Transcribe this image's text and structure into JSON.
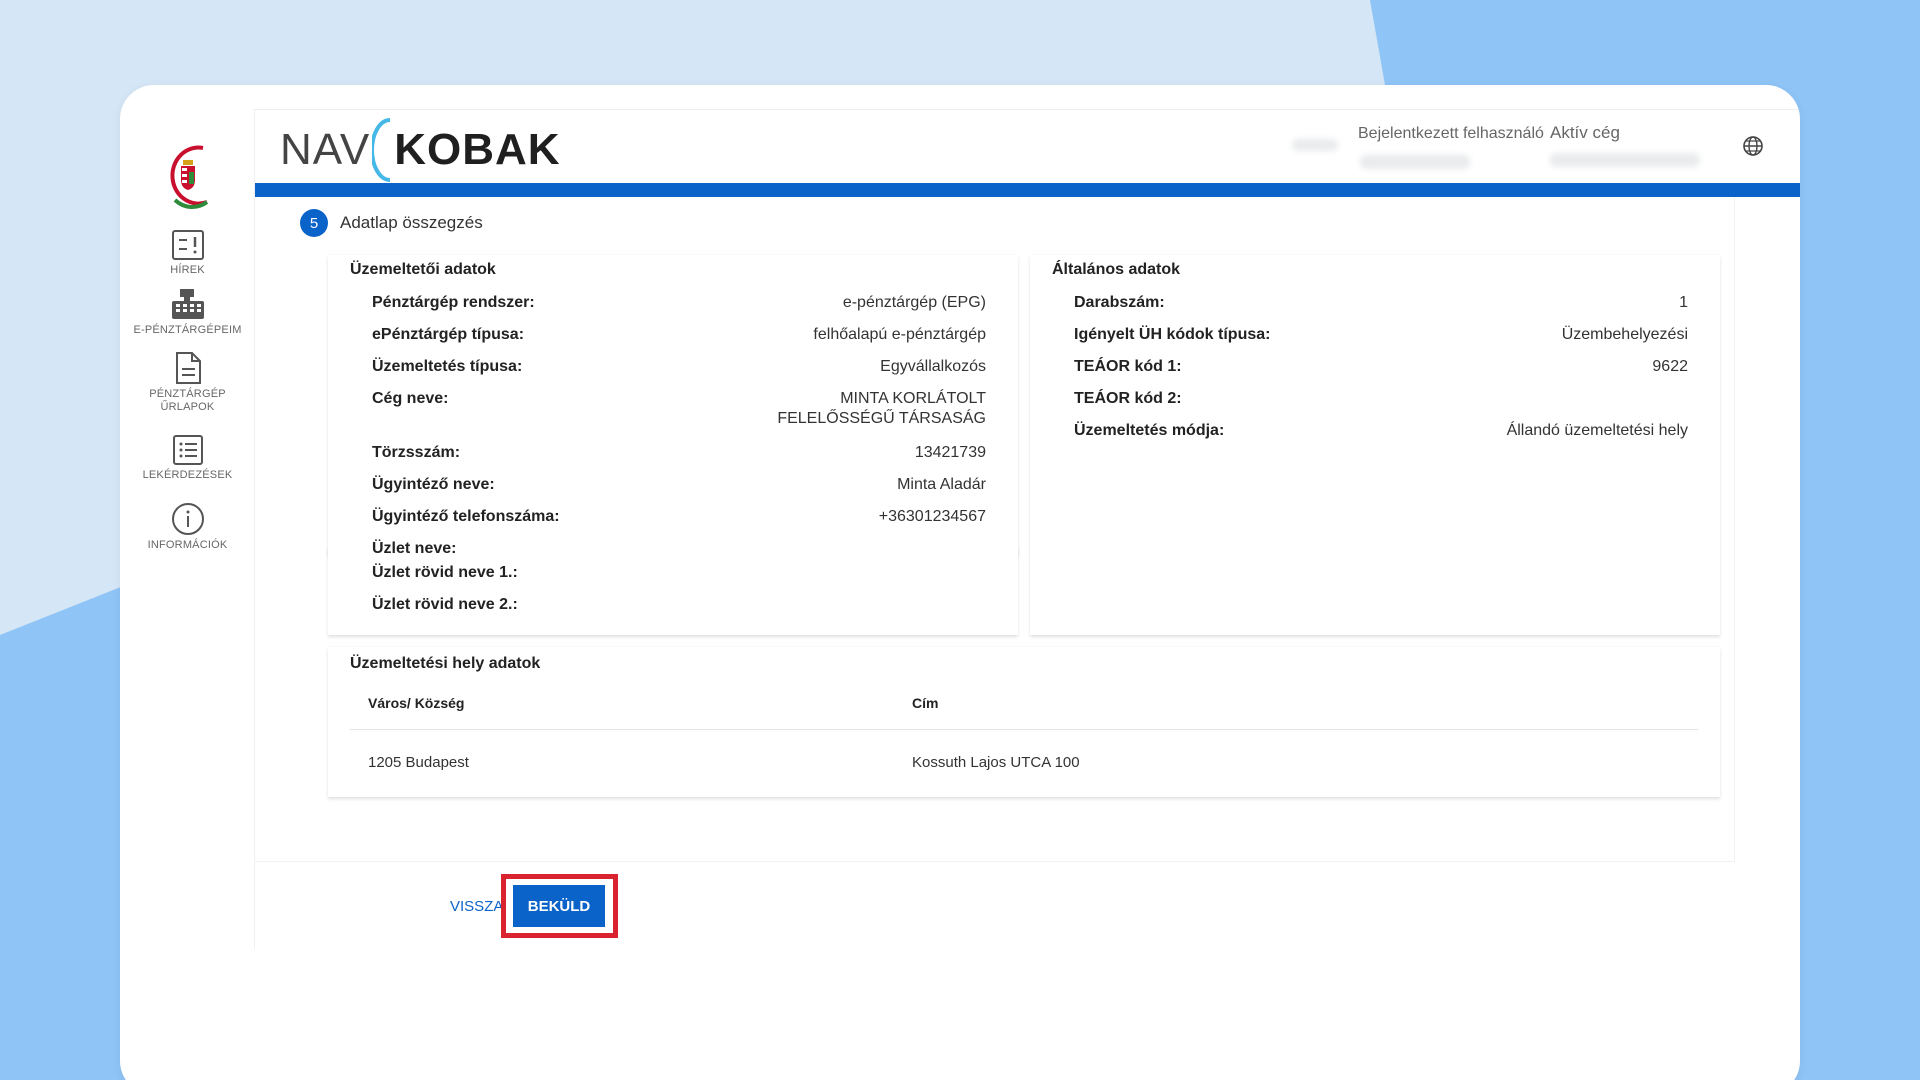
{
  "colors": {
    "brand_blue": "#0a63c9",
    "highlight_red": "#d9232f"
  },
  "brand": {
    "part1": "NAV",
    "part2": "KOBAK"
  },
  "header": {
    "user_label": "Bejelentkezett felhasználó",
    "company_label": "Aktív cég",
    "globe_icon": "globe-icon"
  },
  "sidebar": {
    "items": [
      {
        "label": "HÍREK",
        "icon": "news-icon"
      },
      {
        "label": "E-PÉNZTÁRGÉPEIM",
        "icon": "cash-register-icon"
      },
      {
        "label": "PÉNZTÁRGÉP ŰRLAPOK",
        "line1": "PÉNZTÁRGÉP",
        "line2": "ŰRLAPOK",
        "icon": "document-icon"
      },
      {
        "label": "LEKÉRDEZÉSEK",
        "icon": "list-icon"
      },
      {
        "label": "INFORMÁCIÓK",
        "icon": "info-icon"
      }
    ]
  },
  "step": {
    "number": "5",
    "title": "Adatlap összegzés"
  },
  "operator": {
    "title": "Üzemeltetői adatok",
    "rows": [
      {
        "key": "Pénztárgép rendszer:",
        "value": "e-pénztárgép (EPG)"
      },
      {
        "key": "ePénztárgép típusa:",
        "value": "felhőalapú e-pénztárgép"
      },
      {
        "key": "Üzemeltetés típusa:",
        "value": "Egyvállalkozós"
      },
      {
        "key": "Cég neve:",
        "value_line1": "MINTA KORLÁTOLT",
        "value_line2": "FELELŐSSÉGŰ TÁRSASÁG"
      },
      {
        "key": "Törzsszám:",
        "value": "13421739"
      },
      {
        "key": "Ügyintéző neve:",
        "value": "Minta Aladár"
      },
      {
        "key": "Ügyintéző telefonszáma:",
        "value": "+36301234567"
      },
      {
        "key": "Üzlet neve:",
        "value": ""
      },
      {
        "key": "Üzlet rövid neve 1.:",
        "value": ""
      },
      {
        "key": "Üzlet rövid neve 2.:",
        "value": ""
      }
    ]
  },
  "general": {
    "title": "Általános adatok",
    "rows": [
      {
        "key": "Darabszám:",
        "value": "1"
      },
      {
        "key": "Igényelt ÜH kódok típusa:",
        "value": "Üzembehelyezési"
      },
      {
        "key": "TEÁOR kód 1:",
        "value": "9622"
      },
      {
        "key": "TEÁOR kód 2:",
        "value": ""
      },
      {
        "key": "Üzemeltetés módja:",
        "value": "Állandó üzemeltetési hely"
      }
    ]
  },
  "location": {
    "title": "Üzemeltetési hely adatok",
    "columns": [
      "Város/ Község",
      "Cím"
    ],
    "rows": [
      [
        "1205 Budapest",
        "Kossuth Lajos UTCA 100"
      ]
    ]
  },
  "actions": {
    "back_label": "VISSZA",
    "send_label": "BEKÜLD"
  }
}
